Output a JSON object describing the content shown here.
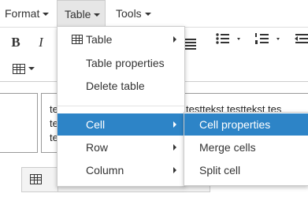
{
  "menubar": {
    "items": [
      {
        "label": "Format"
      },
      {
        "label": "Table"
      },
      {
        "label": "Tools"
      }
    ]
  },
  "toolbar": {
    "bold": "B",
    "italic": "I"
  },
  "editor": {
    "cell_text_lines": [
      "te",
      "te",
      "te"
    ],
    "right_text": "testtekst testtekst tes"
  },
  "table_menu": {
    "items": [
      {
        "label": "Table",
        "icon": "table-grid-icon",
        "submenu": true
      },
      {
        "label": "Table properties"
      },
      {
        "label": "Delete table"
      },
      {
        "label": "Cell",
        "submenu": true,
        "highlighted": true
      },
      {
        "label": "Row",
        "submenu": true
      },
      {
        "label": "Column",
        "submenu": true
      }
    ]
  },
  "cell_submenu": {
    "items": [
      {
        "label": "Cell properties",
        "highlighted": true
      },
      {
        "label": "Merge cells"
      },
      {
        "label": "Split cell"
      }
    ]
  },
  "colors": {
    "highlight": "#2d84c7",
    "menu_border": "#cccccc",
    "text": "#333333"
  }
}
